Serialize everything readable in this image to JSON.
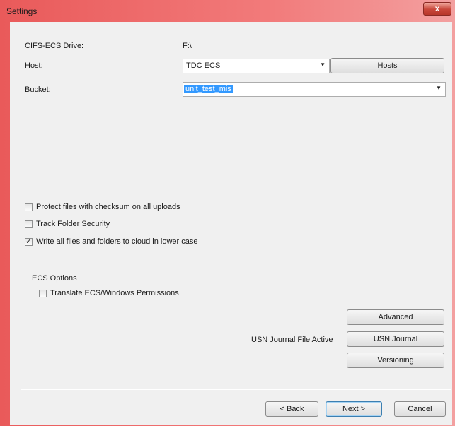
{
  "window": {
    "title": "Settings",
    "close_glyph": "x"
  },
  "drive": {
    "label": "CIFS-ECS Drive:",
    "value": "F:\\"
  },
  "host": {
    "label": "Host:",
    "selected": "TDC ECS",
    "hosts_button": "Hosts"
  },
  "bucket": {
    "label": "Bucket:",
    "value": "unit_test_mis"
  },
  "options": [
    {
      "label": "Protect files with checksum on all uploads",
      "checked": false
    },
    {
      "label": "Track Folder Security",
      "checked": false
    },
    {
      "label": "Write all files and folders to cloud in lower case",
      "checked": true
    }
  ],
  "ecs_options": {
    "heading": "ECS Options",
    "translate_label": "Translate ECS/Windows Permissions",
    "translate_checked": false
  },
  "side_buttons": {
    "advanced": "Advanced",
    "usn_journal": "USN Journal",
    "versioning": "Versioning"
  },
  "usn_status": "USN Journal File Active",
  "footer": {
    "back": "< Back",
    "next": "Next >",
    "cancel": "Cancel"
  },
  "icons": {
    "dropdown": "chevron-down-icon",
    "check": "checkmark-icon"
  },
  "colors": {
    "selection": "#3399ff",
    "frame": "#e95a5a"
  }
}
